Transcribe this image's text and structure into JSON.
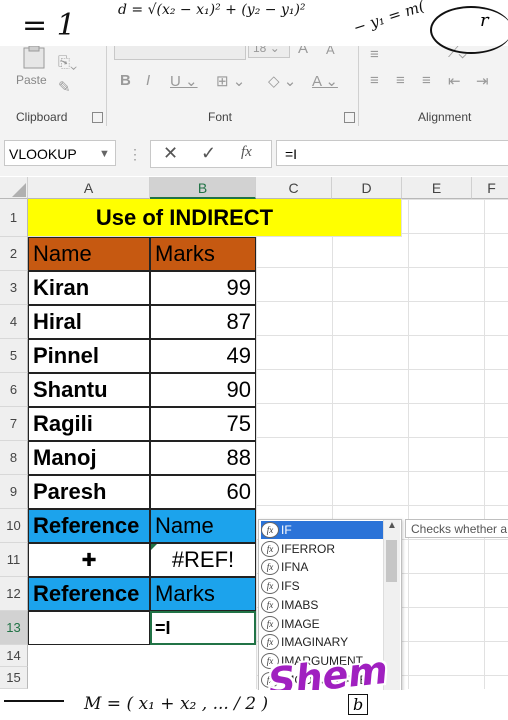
{
  "ribbon": {
    "paste_label": "Paste",
    "clipboard_label": "Clipboard",
    "font_label": "Font",
    "alignment_label": "Alignment",
    "font_size": "18"
  },
  "formula_bar": {
    "name_box": "VLOOKUP",
    "formula": "=I"
  },
  "columns": [
    "A",
    "B",
    "C",
    "D",
    "E",
    "F"
  ],
  "rows": [
    "1",
    "2",
    "3",
    "4",
    "5",
    "6",
    "7",
    "8",
    "9",
    "10",
    "11",
    "12",
    "13",
    "14",
    "15"
  ],
  "sheet": {
    "title": "Use of INDIRECT",
    "header_name": "Name",
    "header_marks": "Marks",
    "students": [
      {
        "name": "Kiran",
        "marks": "99"
      },
      {
        "name": "Hiral",
        "marks": "87"
      },
      {
        "name": "Pinnel",
        "marks": "49"
      },
      {
        "name": "Shantu",
        "marks": "90"
      },
      {
        "name": "Ragili",
        "marks": "75"
      },
      {
        "name": "Manoj",
        "marks": "88"
      },
      {
        "name": "Paresh",
        "marks": "60"
      }
    ],
    "ref1_label": "Reference",
    "ref1_value": "Name",
    "ref_result": "#REF!",
    "ref2_label": "Reference",
    "ref2_value": "Marks",
    "editing_cell": "=I"
  },
  "autocomplete": {
    "items": [
      "IF",
      "IFERROR",
      "IFNA",
      "IFS",
      "IMABS",
      "IMAGE",
      "IMAGINARY",
      "IMARGUMENT",
      "IMCONJUGATE"
    ],
    "tooltip": "Checks whether a"
  },
  "overlays": {
    "top_equation": "= 1",
    "top_formula": "d = √(x₂ − x₁)² + (y₂ − y₁)²",
    "top_right": "− y₁ = m(",
    "top_r": "r",
    "watermark": "Shem",
    "bottom_formula": "M = ( x₁ + x₂ , ... / 2 )",
    "bottom_b": "b"
  },
  "colors": {
    "title_fill": "#ffff00",
    "header_fill": "#c65911",
    "reference_fill": "#1ca3ec",
    "watermark": "#a020c0"
  }
}
